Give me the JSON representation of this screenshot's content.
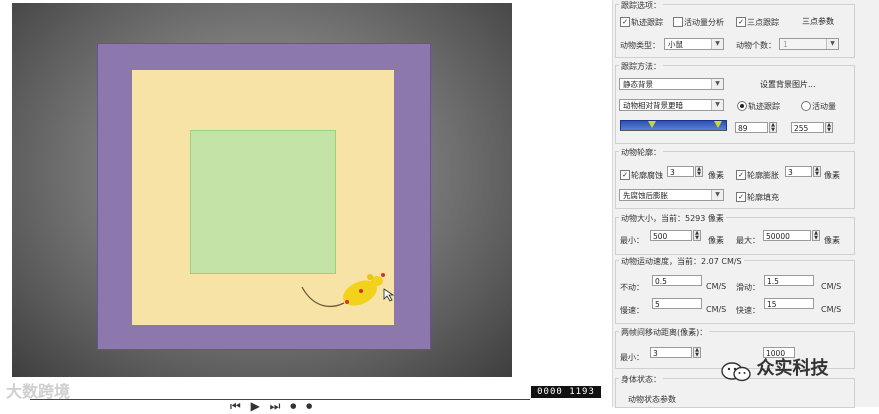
{
  "video": {
    "frame_counter": "0000 1193",
    "logo_text": "大数跨境",
    "playback_glyphs": "⏮ ▶ ⏭ ⏺ ⏺"
  },
  "tracking_options": {
    "title": "跟踪选项：",
    "track_follow": "轨迹跟踪",
    "activity_analysis": "活动量分析",
    "three_point_track": "三点跟踪",
    "three_point_params": "三点参数",
    "animal_type_label": "动物类型：",
    "animal_type_value": "小鼠",
    "animal_count_label": "动物个数：",
    "animal_count_value": "1"
  },
  "tracking_method": {
    "title": "跟踪方法：",
    "method_value": "静态背景",
    "set_background_button": "设置背景图片...",
    "relative_value": "动物相对背景更暗",
    "radio_track": "轨迹跟踪",
    "radio_activity": "活动量",
    "threshold_low": "89",
    "threshold_high": "255"
  },
  "animal_contour": {
    "title": "动物轮廓：",
    "erode_label": "轮廓腐蚀",
    "erode_value": "3",
    "erode_unit": "像素",
    "dilate_label": "轮廓膨胀",
    "dilate_value": "3",
    "dilate_unit": "像素",
    "order_value": "先腐蚀后膨胀",
    "fill_label": "轮廓填充"
  },
  "animal_size": {
    "title": "动物大小，当前：5293 像素",
    "min_label": "最小：",
    "min_value": "500",
    "min_unit": "像素",
    "max_label": "最大：",
    "max_value": "50000",
    "max_unit": "像素"
  },
  "animal_speed": {
    "title": "动物运动速度，当前：2.07 CM/S",
    "still_label": "不动：",
    "still_value": "0.5",
    "still_unit": "CM/S",
    "slow_label": "慢速：",
    "slow_value": "5",
    "slow_unit": "CM/S",
    "creep_label": "滑动：",
    "creep_value": "1.5",
    "creep_unit": "CM/S",
    "fast_label": "快速：",
    "fast_value": "15",
    "fast_unit": "CM/S"
  },
  "frame_distance": {
    "title": "两帧间移动距离(像素)：",
    "min_label": "最小：",
    "min_value": "3",
    "max_value": "1000"
  },
  "body_state": {
    "title": "身体状态：",
    "params_label": "动物状态参数"
  },
  "watermark": {
    "text": "众实科技"
  },
  "colors": {
    "outer_zone": "#8d78ad",
    "inner_floor": "#f6e3a5",
    "center_zone": "#c4e3a6",
    "mouse": "#f2d21a",
    "slider": "#2c4fb5"
  }
}
